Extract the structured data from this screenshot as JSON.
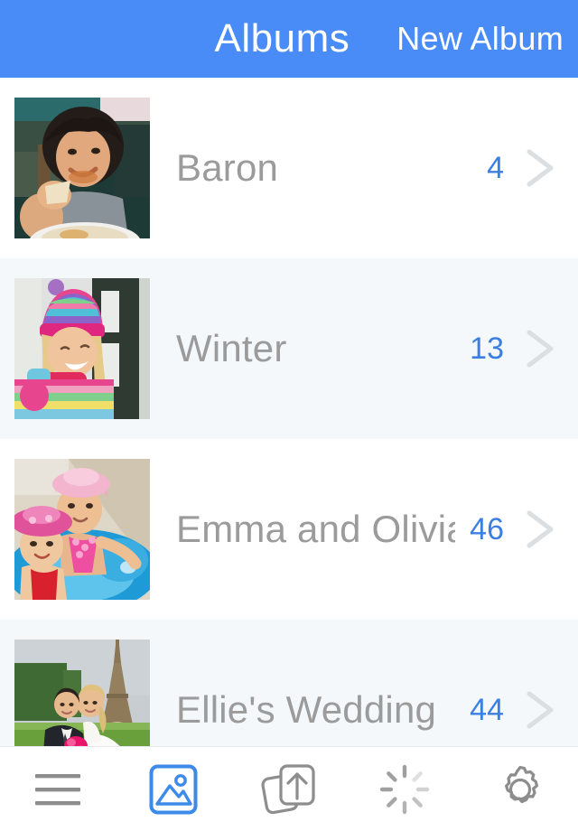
{
  "header": {
    "title": "Albums",
    "new_album_label": "New Album",
    "background_color": "#4a8cf7",
    "text_color": "#ffffff"
  },
  "colors": {
    "accent_blue": "#4a8cf7",
    "count_blue": "#3d7fe0",
    "row_even_bg": "#f4f8fb",
    "row_odd_bg": "#ffffff",
    "album_name_gray": "#9b9b9b",
    "chevron_gray": "#dcdfe2",
    "toolbar_icon_gray": "#8d8d8d"
  },
  "albums": [
    {
      "name": "Baron",
      "count": "4",
      "thumbnail": "boy-eating-photo"
    },
    {
      "name": "Winter",
      "count": "13",
      "thumbnail": "girl-winter-hat-photo"
    },
    {
      "name": "Emma and Olivia",
      "count": "46",
      "thumbnail": "girls-in-pool-photo"
    },
    {
      "name": "Ellie's Wedding",
      "count": "44",
      "thumbnail": "wedding-eiffel-tower-photo"
    }
  ],
  "toolbar": {
    "items": [
      {
        "icon": "hamburger-menu-icon",
        "active": false
      },
      {
        "icon": "photo-library-icon",
        "active": true
      },
      {
        "icon": "upload-icon",
        "active": false
      },
      {
        "icon": "loading-spinner-icon",
        "active": false
      },
      {
        "icon": "gear-icon",
        "active": false
      }
    ]
  }
}
